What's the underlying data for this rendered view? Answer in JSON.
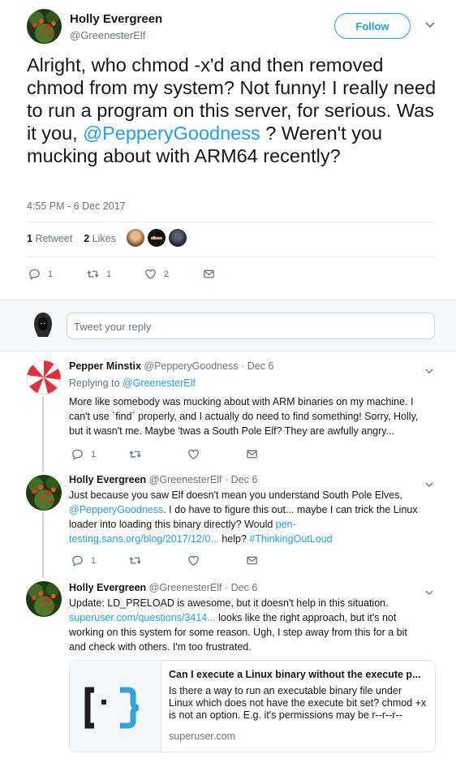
{
  "main_tweet": {
    "name": "Holly Evergreen",
    "handle": "@GreenesterElf",
    "follow_label": "Follow",
    "text_before": "Alright, who chmod -x'd and then removed chmod from my system? Not funny! I really need to run a program on this server, for serious. Was it you, ",
    "mention": "@PepperyGoodness",
    "text_after": " ? Weren't you mucking about with ARM64 recently?",
    "timestamp": "4:55 PM - 6 Dec 2017",
    "retweet_count": "1",
    "retweet_label": "Retweet",
    "like_count": "2",
    "like_label": "Likes",
    "actions": {
      "reply": "1",
      "retweet": "1",
      "like": "2"
    }
  },
  "reply_box": {
    "placeholder": "Tweet your reply"
  },
  "replies": [
    {
      "name": "Pepper Minstix",
      "handle": "@PepperyGoodness",
      "sep": "·",
      "date": "Dec 6",
      "replying_label": "Replying to ",
      "replying_to": "@GreenesterElf",
      "text": "More like somebody was mucking about with ARM binaries on my machine. I can't use `find` properly, and I actually do need to find something! Sorry, Holly, but it wasn't me. Maybe 'twas a South Pole Elf? They are awfully angry...",
      "reply_count": "1"
    },
    {
      "name": "Holly Evergreen",
      "handle": "@GreenesterElf",
      "sep": "·",
      "date": "Dec 6",
      "text_1": "Just because you saw Elf doesn't mean you understand South Pole Elves, ",
      "mention": "@PepperyGoodness",
      "text_2": ". I do have to figure this out... maybe I can trick the Linux loader into loading this binary directly? Would ",
      "link": "pen-testing.sans.org/blog/2017/12/0...",
      "text_3": " help? ",
      "hashtag": "#ThinkingOutLoud",
      "reply_count": "1"
    },
    {
      "name": "Holly Evergreen",
      "handle": "@GreenesterElf",
      "sep": "·",
      "date": "Dec 6",
      "text_1": "Update: LD_PRELOAD is awesome, but it doesn't help in this situation. ",
      "link": "superuser.com/questions/3414...",
      "text_2": " looks like the right approach, but it's not working on this system for some reason. Ugh, I step away from this for a bit and check with others. I'm too frustrated.",
      "card": {
        "title": "Can I execute a Linux binary without the execute p...",
        "description": "Is there a way to run an executable binary file under Linux which does not have the execute bit set? chmod +x is not an option. E.g. it's permissions may be r--r--r--",
        "domain": "superuser.com"
      }
    }
  ],
  "colors": {
    "accent": "#1da1f2",
    "secondary_text": "#657786",
    "divider": "#e6ecf0"
  }
}
